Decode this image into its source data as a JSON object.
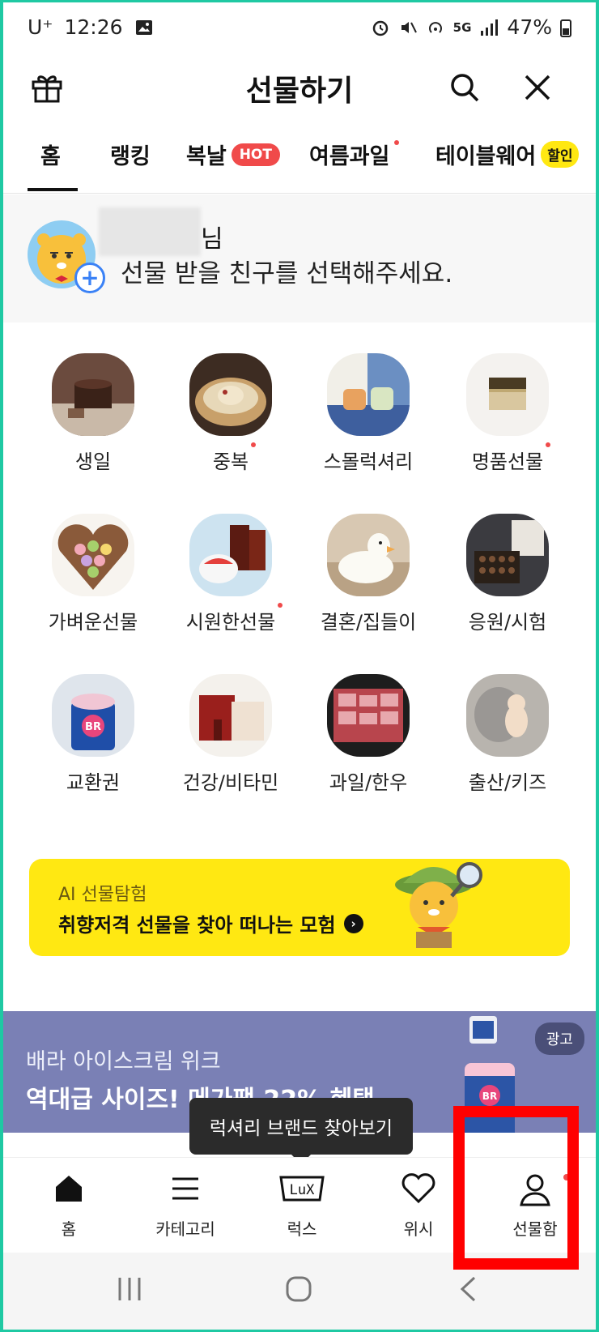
{
  "status_bar": {
    "carrier": "U⁺",
    "time": "12:26",
    "network": "5G",
    "battery": "47%"
  },
  "header": {
    "title": "선물하기",
    "icons": [
      "gift-icon",
      "search-icon",
      "close-icon"
    ]
  },
  "tabs": [
    {
      "label": "홈",
      "active": true
    },
    {
      "label": "랭킹"
    },
    {
      "label": "복날",
      "badge": "HOT"
    },
    {
      "label": "여름과일",
      "dot": true
    },
    {
      "label": "테이블웨어",
      "badge": "할인"
    }
  ],
  "friend_select": {
    "suffix": "님",
    "prompt": "선물 받을 친구를 선택해주세요."
  },
  "categories": [
    {
      "label": "생일"
    },
    {
      "label": "중복",
      "dot": true
    },
    {
      "label": "스몰럭셔리"
    },
    {
      "label": "명품선물",
      "dot": true
    },
    {
      "label": "가벼운선물"
    },
    {
      "label": "시원한선물",
      "dot": true
    },
    {
      "label": "결혼/집들이"
    },
    {
      "label": "응원/시험"
    },
    {
      "label": "교환권"
    },
    {
      "label": "건강/비타민"
    },
    {
      "label": "과일/한우"
    },
    {
      "label": "출산/키즈"
    }
  ],
  "ai_banner": {
    "subtitle": "AI 선물탐험",
    "title": "취향저격 선물을 찾아 떠나는 모험"
  },
  "ad_banner": {
    "subtitle": "배라 아이스크림 위크",
    "title": "역대급 사이즈! 메가팩 22% 혜택",
    "badge": "광고"
  },
  "tooltip": "럭셔리 브랜드 찾아보기",
  "bottom_nav": [
    {
      "label": "홈",
      "icon": "home-icon"
    },
    {
      "label": "카테고리",
      "icon": "menu-icon"
    },
    {
      "label": "럭스",
      "icon": "lux-icon",
      "icon_text": "LuX"
    },
    {
      "label": "위시",
      "icon": "heart-icon"
    },
    {
      "label": "선물함",
      "icon": "person-icon",
      "dot": true
    }
  ],
  "colors": {
    "accent_yellow": "#ffe812",
    "hot_red": "#f04a4a",
    "ad_bg": "#7a80b5",
    "highlight": "#ff0000"
  }
}
